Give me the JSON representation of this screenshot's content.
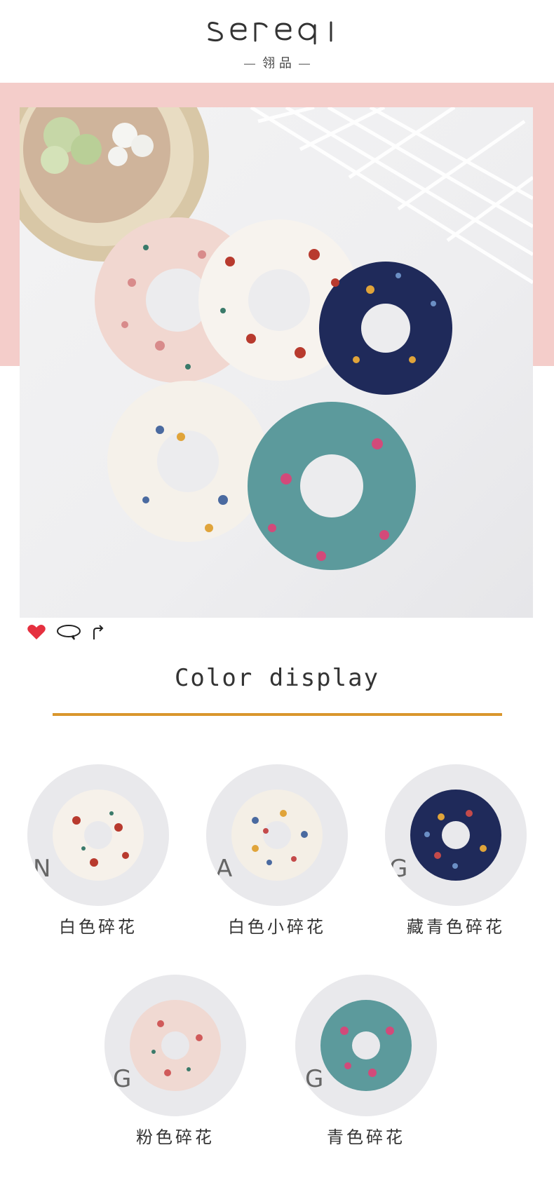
{
  "brand": {
    "name": "SEREQI",
    "sub": "翎 品"
  },
  "section": {
    "title": "Color display"
  },
  "colors": {
    "pink_band": "#f4cdca",
    "rule": "#d9962c",
    "heart": "#e5303f"
  },
  "social_icons": [
    "heart-icon",
    "comment-icon",
    "share-icon"
  ],
  "variants": [
    {
      "label": "白色碎花"
    },
    {
      "label": "白色小碎花"
    },
    {
      "label": "藏青色碎花"
    },
    {
      "label": "粉色碎花"
    },
    {
      "label": "青色碎花"
    }
  ]
}
